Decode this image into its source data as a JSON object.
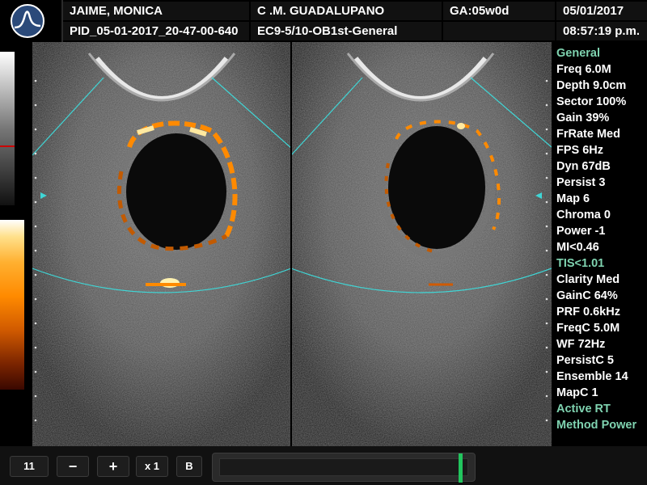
{
  "header": {
    "patient_name": "JAIME, MONICA",
    "patient_id": "PID_05-01-2017_20-47-00-640",
    "institution": "C .M. GUADALUPANO",
    "probe_preset": "EC9-5/10-OB1st-General",
    "gestational_age": "GA:05w0d",
    "date": "05/01/2017",
    "time": "08:57:19 p.m."
  },
  "params": [
    {
      "text": "General",
      "accent": true
    },
    {
      "text": "Freq 6.0M"
    },
    {
      "text": "Depth 9.0cm"
    },
    {
      "text": "Sector 100%"
    },
    {
      "text": "Gain 39%"
    },
    {
      "text": "FrRate Med"
    },
    {
      "text": "FPS 6Hz"
    },
    {
      "text": "Dyn 67dB"
    },
    {
      "text": "Persist 3"
    },
    {
      "text": "Map 6"
    },
    {
      "text": "Chroma 0"
    },
    {
      "text": "Power -1"
    },
    {
      "text": "MI<0.46"
    },
    {
      "text": "TIS<1.01",
      "accent": true
    },
    {
      "text": "Clarity Med"
    },
    {
      "text": "GainC 64%"
    },
    {
      "text": "PRF 0.6kHz"
    },
    {
      "text": "FreqC 5.0M"
    },
    {
      "text": "WF 72Hz"
    },
    {
      "text": "PersistC 5"
    },
    {
      "text": "Ensemble 14"
    },
    {
      "text": "MapC 1"
    },
    {
      "text": "Active RT",
      "accent": true
    },
    {
      "text": "Method Power",
      "accent": true
    }
  ],
  "bottombar": {
    "zoom_value": "11",
    "minus_label": "−",
    "plus_label": "+",
    "magnify_label": "x 1",
    "mode_label": "B"
  },
  "colors": {
    "accent": "#7fd3b0",
    "sector_line": "#3fd6d6",
    "doppler_hot": "#ff8a00",
    "cine_marker": "#22c55e"
  }
}
